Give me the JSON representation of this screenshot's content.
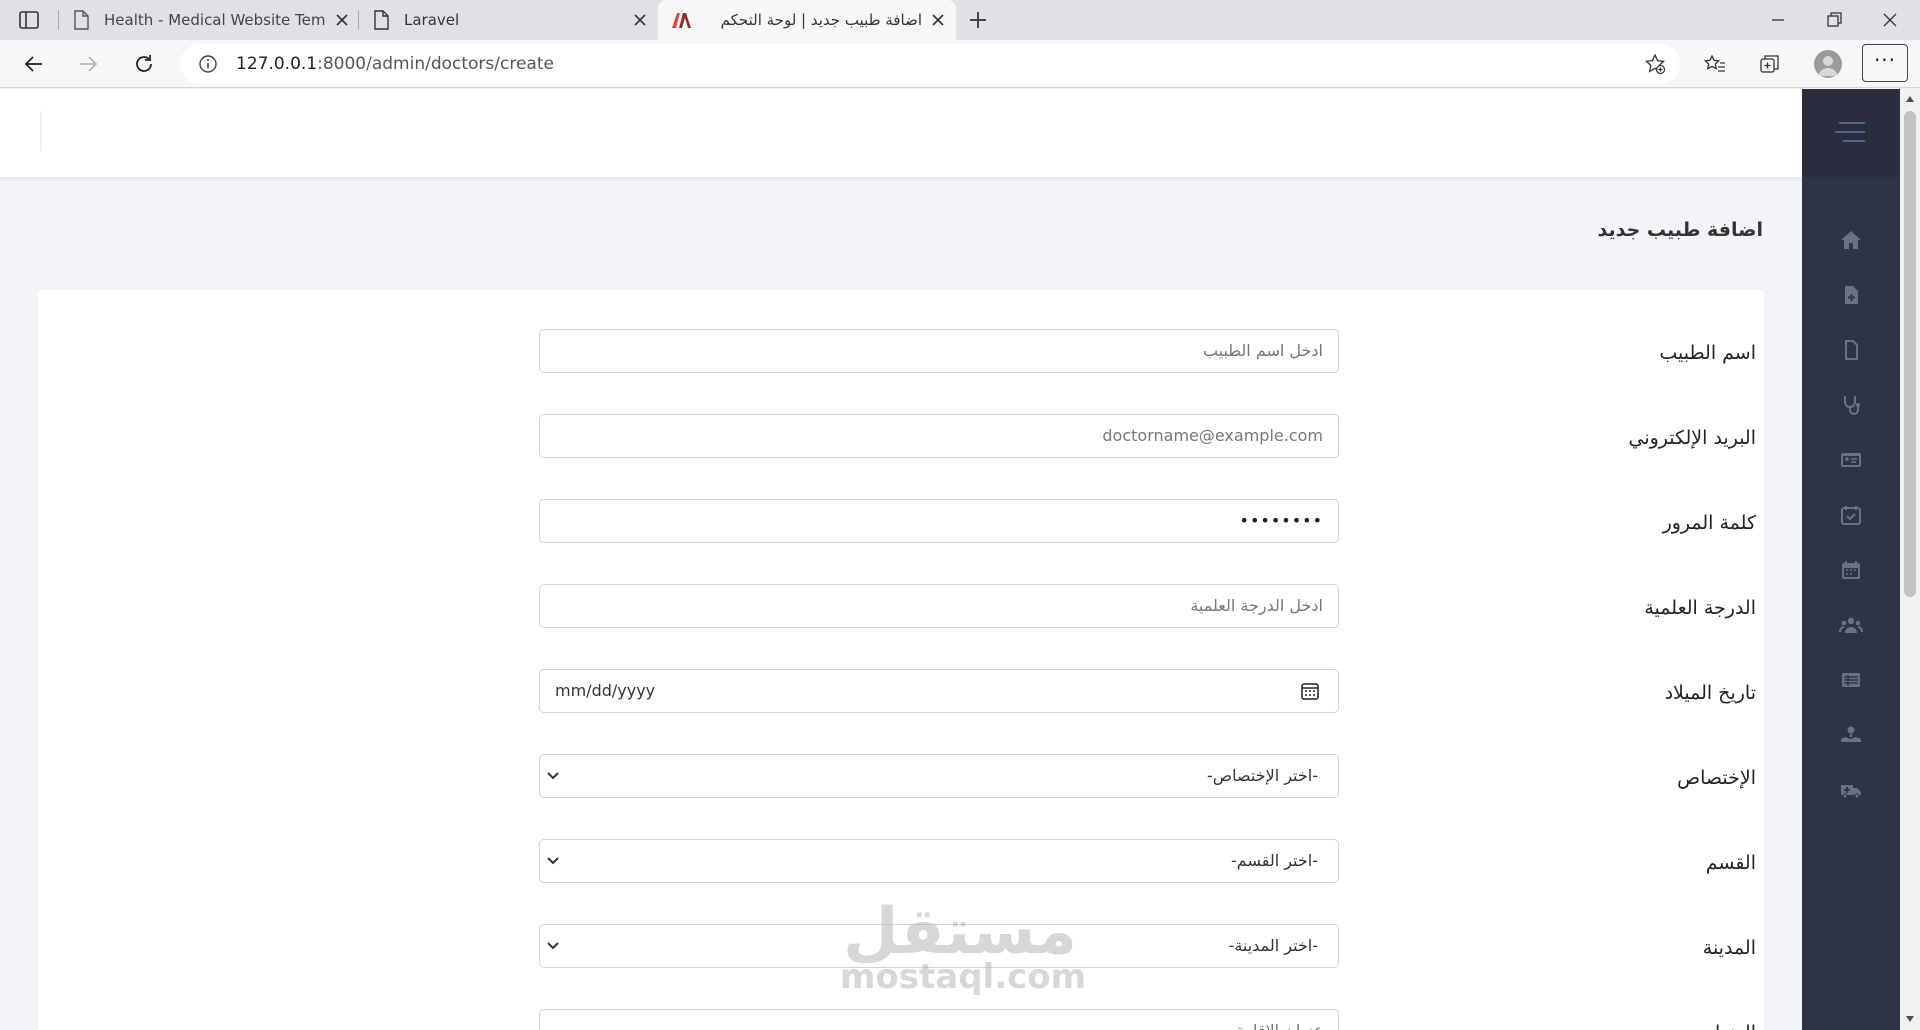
{
  "browser": {
    "tabs": [
      {
        "title": "Health - Medical Website Templ",
        "favicon": "page-icon"
      },
      {
        "title": "Laravel",
        "favicon": "page-icon"
      },
      {
        "title": "اضافة طبيب جديد | لوحة التحكم",
        "favicon": "app-logo-icon",
        "active": true
      }
    ],
    "url_host": "127.0.0.1",
    "url_path": ":8000/admin/doctors/create"
  },
  "page": {
    "title": "اضافة طبيب جديد"
  },
  "sidebar": {
    "icons": [
      "home-icon",
      "file-medical-icon",
      "file-icon",
      "stethoscope-icon",
      "id-card-icon",
      "calendar-check-icon",
      "calendar-icon",
      "users-icon",
      "table-list-icon",
      "user-hand-icon",
      "ambulance-icon"
    ]
  },
  "form": {
    "name": {
      "label": "اسم الطبيب",
      "placeholder": "ادخل اسم الطبيب"
    },
    "email": {
      "label": "البريد الإلكتروني",
      "placeholder": "doctorname@example.com"
    },
    "password": {
      "label": "كلمة المرور",
      "value": "••••••••"
    },
    "degree": {
      "label": "الدرجة العلمية",
      "placeholder": "ادخل الدرجة العلمية"
    },
    "birthdate": {
      "label": "تاريخ الميلاد",
      "value": "mm/dd/yyyy"
    },
    "specialty": {
      "label": "الإختصاص",
      "selected": "-اختر الإختصاص-"
    },
    "department": {
      "label": "القسم",
      "selected": "-اختر القسم-"
    },
    "city": {
      "label": "المدينة",
      "selected": "-اختر المدينة-"
    },
    "address": {
      "label": "العنوان",
      "placeholder": "عنوان الإقامة"
    }
  },
  "watermark": {
    "arabic": "مستقل",
    "latin": "mostaql.com"
  },
  "colors": {
    "sidebar": "#2e3345",
    "sidebar_icons": "#6b7185",
    "page_bg": "#f3f4f7",
    "card_bg": "#ffffff",
    "input_border": "#ced4da"
  }
}
